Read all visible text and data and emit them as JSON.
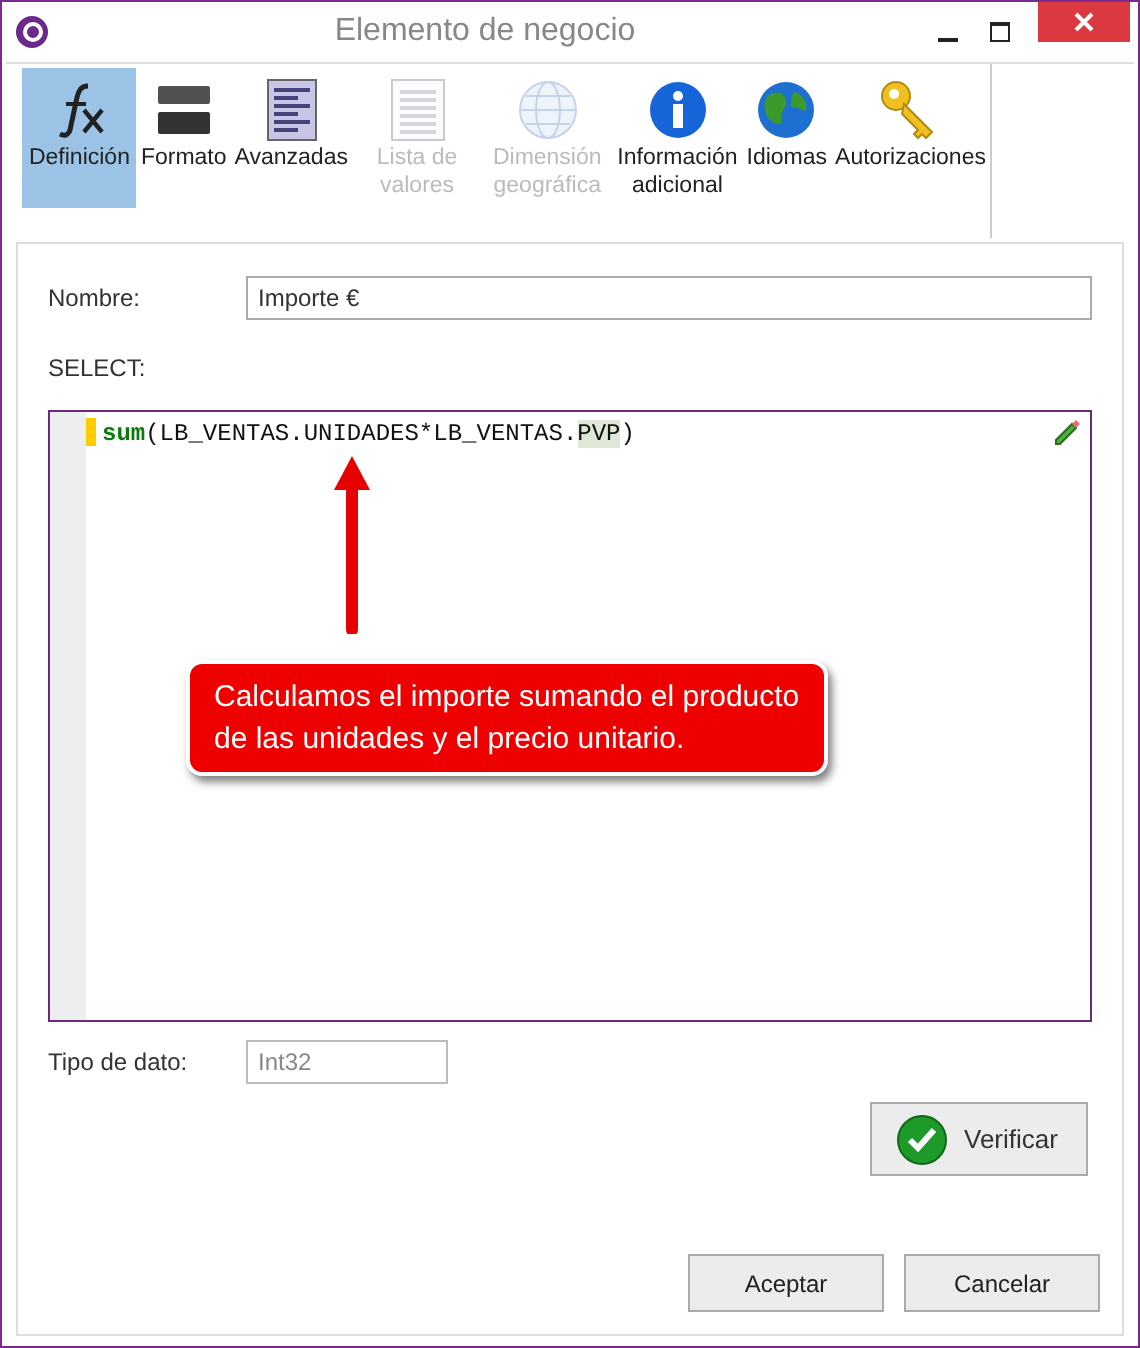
{
  "window": {
    "title": "Elemento de negocio"
  },
  "toolbar": [
    {
      "kind": "formula",
      "label": "Definición",
      "selected": true,
      "disabled": false
    },
    {
      "kind": "format",
      "label": "Formato",
      "selected": false,
      "disabled": false
    },
    {
      "kind": "advanced",
      "label": "Avanzadas",
      "selected": false,
      "disabled": false
    },
    {
      "kind": "list",
      "label": "Lista de valores",
      "selected": false,
      "disabled": true
    },
    {
      "kind": "globe",
      "label": "Dimensión geográfica",
      "selected": false,
      "disabled": true
    },
    {
      "kind": "info",
      "label": "Información adicional",
      "selected": false,
      "disabled": false
    },
    {
      "kind": "earth",
      "label": "Idiomas",
      "selected": false,
      "disabled": false
    },
    {
      "kind": "key",
      "label": "Autorizaciones",
      "selected": false,
      "disabled": false
    }
  ],
  "name_field": {
    "label": "Nombre:",
    "value": "Importe €"
  },
  "select_label": "SELECT:",
  "code": [
    {
      "kind": "function",
      "text": "sum"
    },
    {
      "kind": "plain",
      "text": "(LB_VENTAS.UNIDADES*LB_VENTAS."
    },
    {
      "kind": "highlight",
      "text": "PVP"
    },
    {
      "kind": "plain",
      "text": ")"
    }
  ],
  "callout": "Calculamos el importe sumando el producto de las unidades y el precio unitario.",
  "type_field": {
    "label": "Tipo de dato:",
    "value": "Int32"
  },
  "verify_button": "Verificar",
  "buttons": [
    "Aceptar",
    "Cancelar"
  ]
}
